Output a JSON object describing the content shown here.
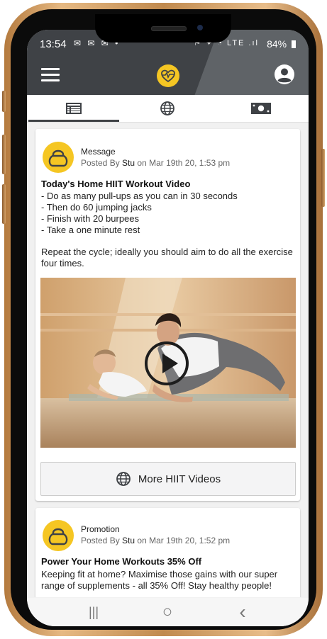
{
  "status_bar": {
    "time": "13:54",
    "notification_icons": "✉ ✉ ✉ •",
    "system_icons": "⚑ ✦ ◔ LTE .ıl",
    "battery": "84%"
  },
  "app_bar": {
    "menu_icon": "menu-icon",
    "logo_icon": "heart-pulse-icon",
    "account_icon": "account-circle-icon",
    "brand_color": "#f5c623",
    "bar_color": "#3f4246"
  },
  "tabs": [
    {
      "icon": "news-feed-icon",
      "active": true
    },
    {
      "icon": "globe-icon",
      "active": false
    },
    {
      "icon": "money-icon",
      "active": false
    }
  ],
  "posts": [
    {
      "type": "Message",
      "posted_by_prefix": "Posted By",
      "author": "Stu",
      "date": "on Mar 19th 20, 1:53 pm",
      "title": "Today's Home HIIT Workout Video",
      "lines": [
        "- Do as many pull-ups as you can in 30 seconds",
        "- Then do 60 jumping jacks",
        "- Finish with 20 burpees",
        "- Take a one minute rest"
      ],
      "paragraph_1": "Repeat the cycle; ideally you should aim to do all the exercise",
      "paragraph_2": "four times.",
      "button_label": "More HIIT Videos"
    },
    {
      "type": "Promotion",
      "posted_by_prefix": "Posted By",
      "author": "Stu",
      "date": "on Mar 19th 20, 1:52 pm",
      "title": "Power Your Home Workouts 35% Off",
      "line_1": "Keeping fit at home? Maximise those gains with our super",
      "line_2": "range of supplements - all 35% Off! Stay healthy people!"
    }
  ],
  "nav_bar": {
    "recents": "|||",
    "home": "○",
    "back": "‹"
  }
}
